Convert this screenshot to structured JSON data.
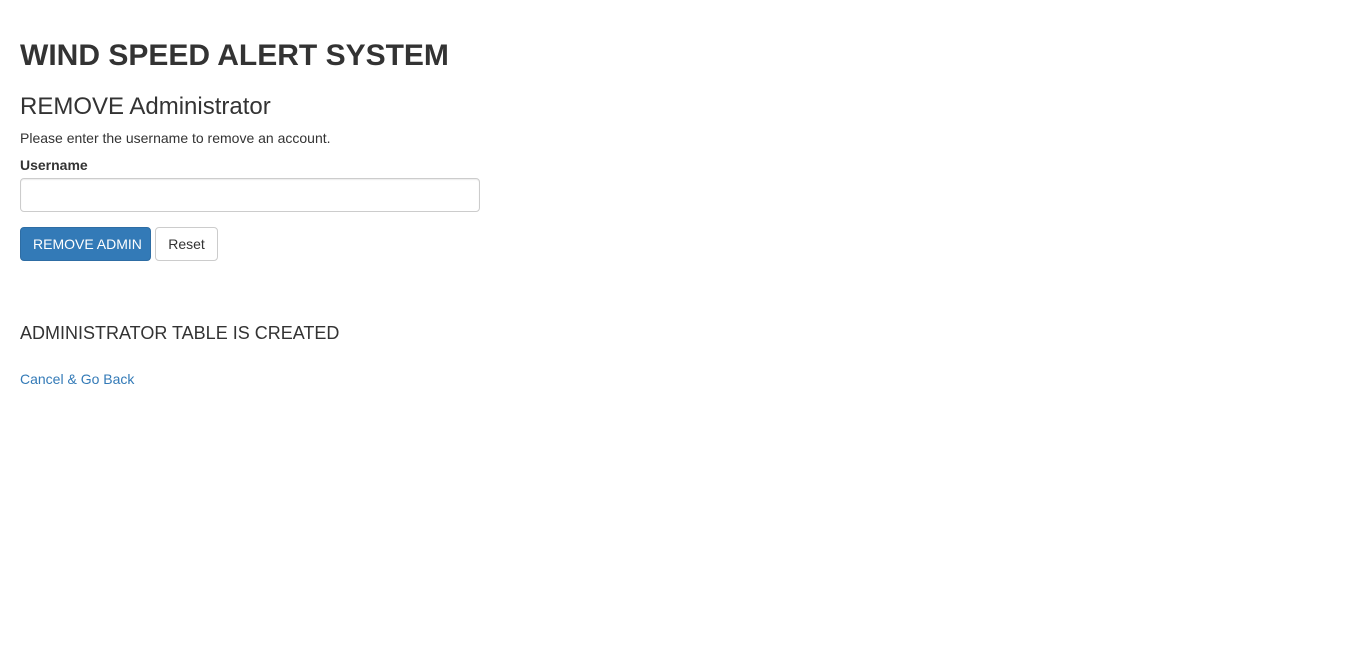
{
  "header": {
    "app_title": "WIND SPEED ALERT SYSTEM"
  },
  "form": {
    "section_title": "REMOVE Administrator",
    "instructions": "Please enter the username to remove an account.",
    "username_label": "Username",
    "username_value": "",
    "username_placeholder": "",
    "submit_label": "REMOVE ADMIN",
    "reset_label": "Reset"
  },
  "status": {
    "message": "ADMINISTRATOR TABLE IS CREATED"
  },
  "links": {
    "back_label": "Cancel & Go Back"
  },
  "colors": {
    "primary": "#337ab7",
    "text": "#333333",
    "link": "#337ab7"
  }
}
